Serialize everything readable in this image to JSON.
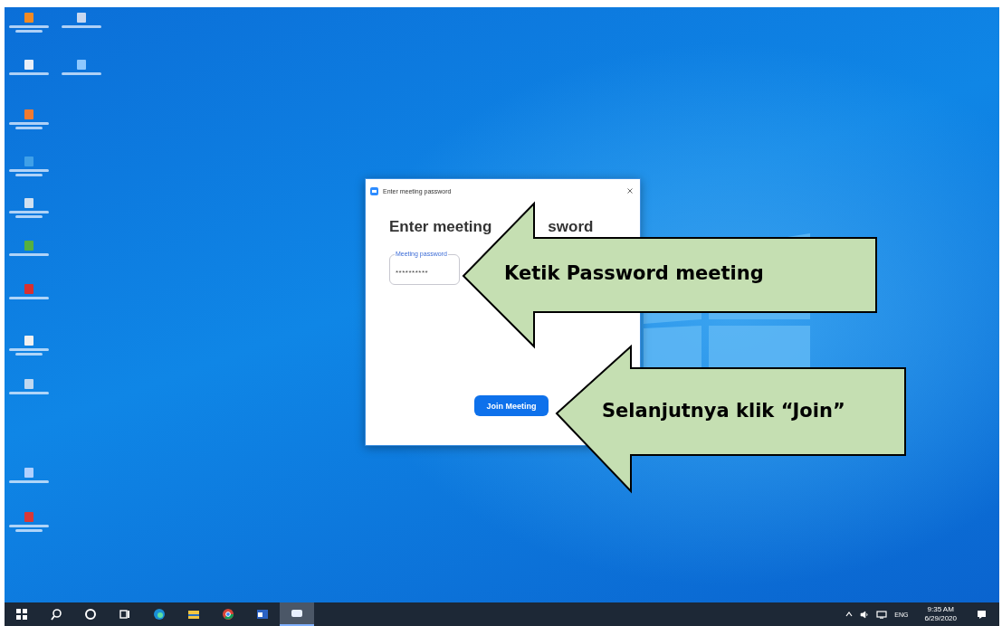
{
  "dialog": {
    "title": "Enter meeting password",
    "heading_parts": [
      "Enter meeting",
      "sword"
    ],
    "field": {
      "label": "Meeting password",
      "value": "**********"
    },
    "button": "Join Meeting"
  },
  "callouts": [
    {
      "text": "Ketik Password meeting"
    },
    {
      "text": "Selanjutnya klik “Join”"
    }
  ],
  "taskbar": {
    "apps": [
      {
        "kind": "start",
        "selected": false
      },
      {
        "kind": "search",
        "selected": false
      },
      {
        "kind": "cortana",
        "selected": false
      },
      {
        "kind": "taskview",
        "selected": false
      },
      {
        "kind": "edge",
        "selected": false
      },
      {
        "kind": "explorer",
        "selected": false
      },
      {
        "kind": "chrome",
        "selected": false
      },
      {
        "kind": "word",
        "selected": false
      },
      {
        "kind": "zoom",
        "selected": true
      }
    ],
    "tray": {
      "language": "ENG",
      "time": "9:35 AM",
      "date": "6/29/2020"
    }
  }
}
